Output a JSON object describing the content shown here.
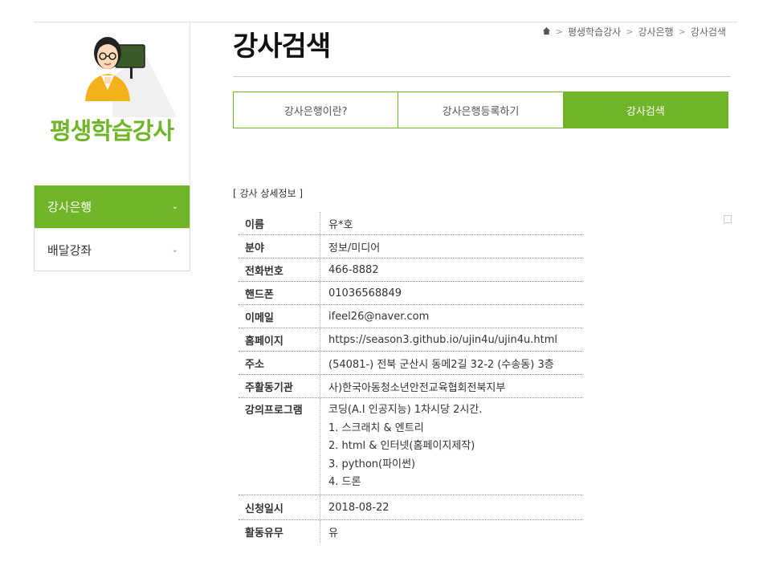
{
  "sidebar": {
    "title": "평생학습강사",
    "menu": [
      {
        "label": "강사은행",
        "active": true
      },
      {
        "label": "배달강좌",
        "active": false
      }
    ]
  },
  "header": {
    "title": "강사검색",
    "breadcrumb": [
      "평생학습강사",
      "강사은행",
      "강사검색"
    ],
    "home_icon": "home-icon"
  },
  "tabs": [
    {
      "label": "강사은행이란?",
      "active": false
    },
    {
      "label": "강사은행등록하기",
      "active": false
    },
    {
      "label": "강사검색",
      "active": true
    }
  ],
  "section_label": "[ 강사 상세정보 ]",
  "detail": {
    "rows": [
      {
        "key": "이름",
        "value": "유*호"
      },
      {
        "key": "분야",
        "value": "정보/미디어"
      },
      {
        "key": "전화번호",
        "value": "466-8882"
      },
      {
        "key": "핸드폰",
        "value": "01036568849"
      },
      {
        "key": "이메일",
        "value": "ifeel26@naver.com"
      },
      {
        "key": "홈페이지",
        "value": "https://season3.github.io/ujin4u/ujin4u.html"
      },
      {
        "key": "주소",
        "value": "(54081-) 전북 군산시 동메2길 32-2 (수송동) 3층"
      },
      {
        "key": "주활동기관",
        "value": "사)한국아동청소년안전교육협회전북지부"
      }
    ],
    "program": {
      "key": "강의프로그램",
      "lines": [
        "코딩(A.I 인공지능) 1차시당 2시간.",
        "1. 스크래치 & 엔트리",
        "2. html & 인터넷(홈페이지제작)",
        "3. python(파이썬)",
        "4. 드론"
      ]
    },
    "tail": [
      {
        "key": "신청일시",
        "value": "2018-08-22"
      },
      {
        "key": "활동유무",
        "value": "유"
      }
    ]
  },
  "colors": {
    "accent": "#6fb527"
  }
}
